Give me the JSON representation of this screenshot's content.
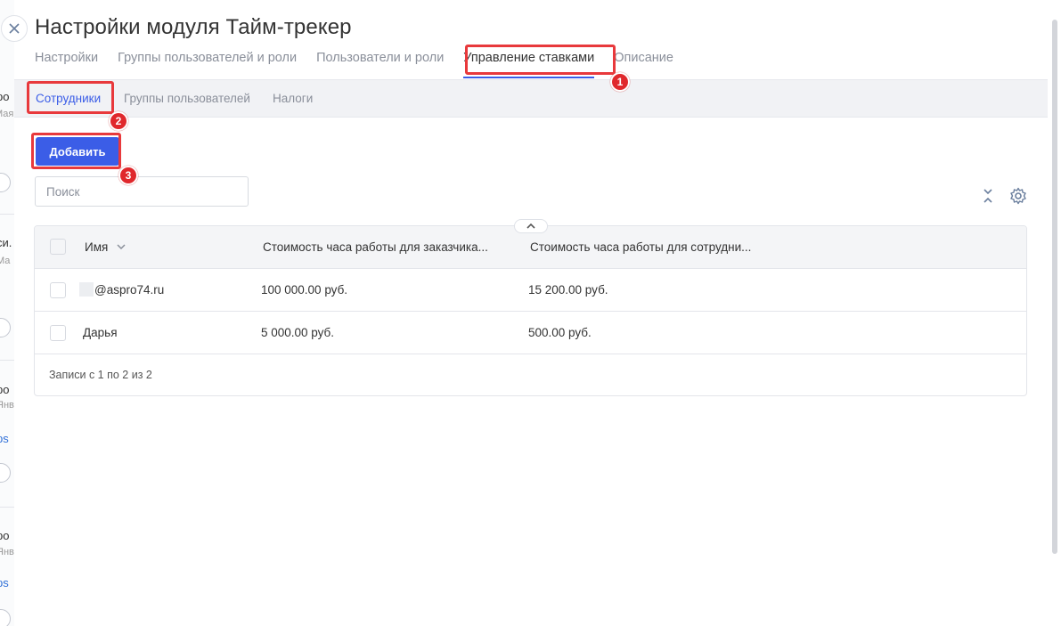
{
  "background": {
    "fragments": [
      "ро",
      "Мая",
      "си.",
      "Ма",
      "ро",
      "Янв",
      "ps",
      "ро",
      "Янв",
      "ps"
    ]
  },
  "panel": {
    "title": "Настройки модуля Тайм-трекер",
    "tabs": [
      {
        "label": "Настройки"
      },
      {
        "label": "Группы пользователей и роли"
      },
      {
        "label": "Пользователи и роли"
      },
      {
        "label": "Управление ставками"
      },
      {
        "label": "Описание"
      }
    ],
    "active_tab": "Управление ставками",
    "subtabs": [
      {
        "label": "Сотрудники"
      },
      {
        "label": "Группы пользователей"
      },
      {
        "label": "Налоги"
      }
    ],
    "active_subtab": "Сотрудники",
    "add_button": "Добавить",
    "search_placeholder": "Поиск"
  },
  "table": {
    "columns": [
      "Имя",
      "Стоимость часа работы для заказчика...",
      "Стоимость часа работы для сотрудни..."
    ],
    "rows": [
      {
        "name": "@aspro74.ru",
        "client_rate": "100 000.00 руб.",
        "employee_rate": "15 200.00 руб."
      },
      {
        "name": "Дарья",
        "client_rate": "5 000.00 руб.",
        "employee_rate": "500.00 руб."
      }
    ],
    "footer": "Записи с 1 по 2 из 2"
  },
  "annotations": {
    "badges": [
      "1",
      "2",
      "3"
    ],
    "color": "#e8393c"
  },
  "colors": {
    "accent": "#3b5de7",
    "highlight": "#e8393c"
  }
}
